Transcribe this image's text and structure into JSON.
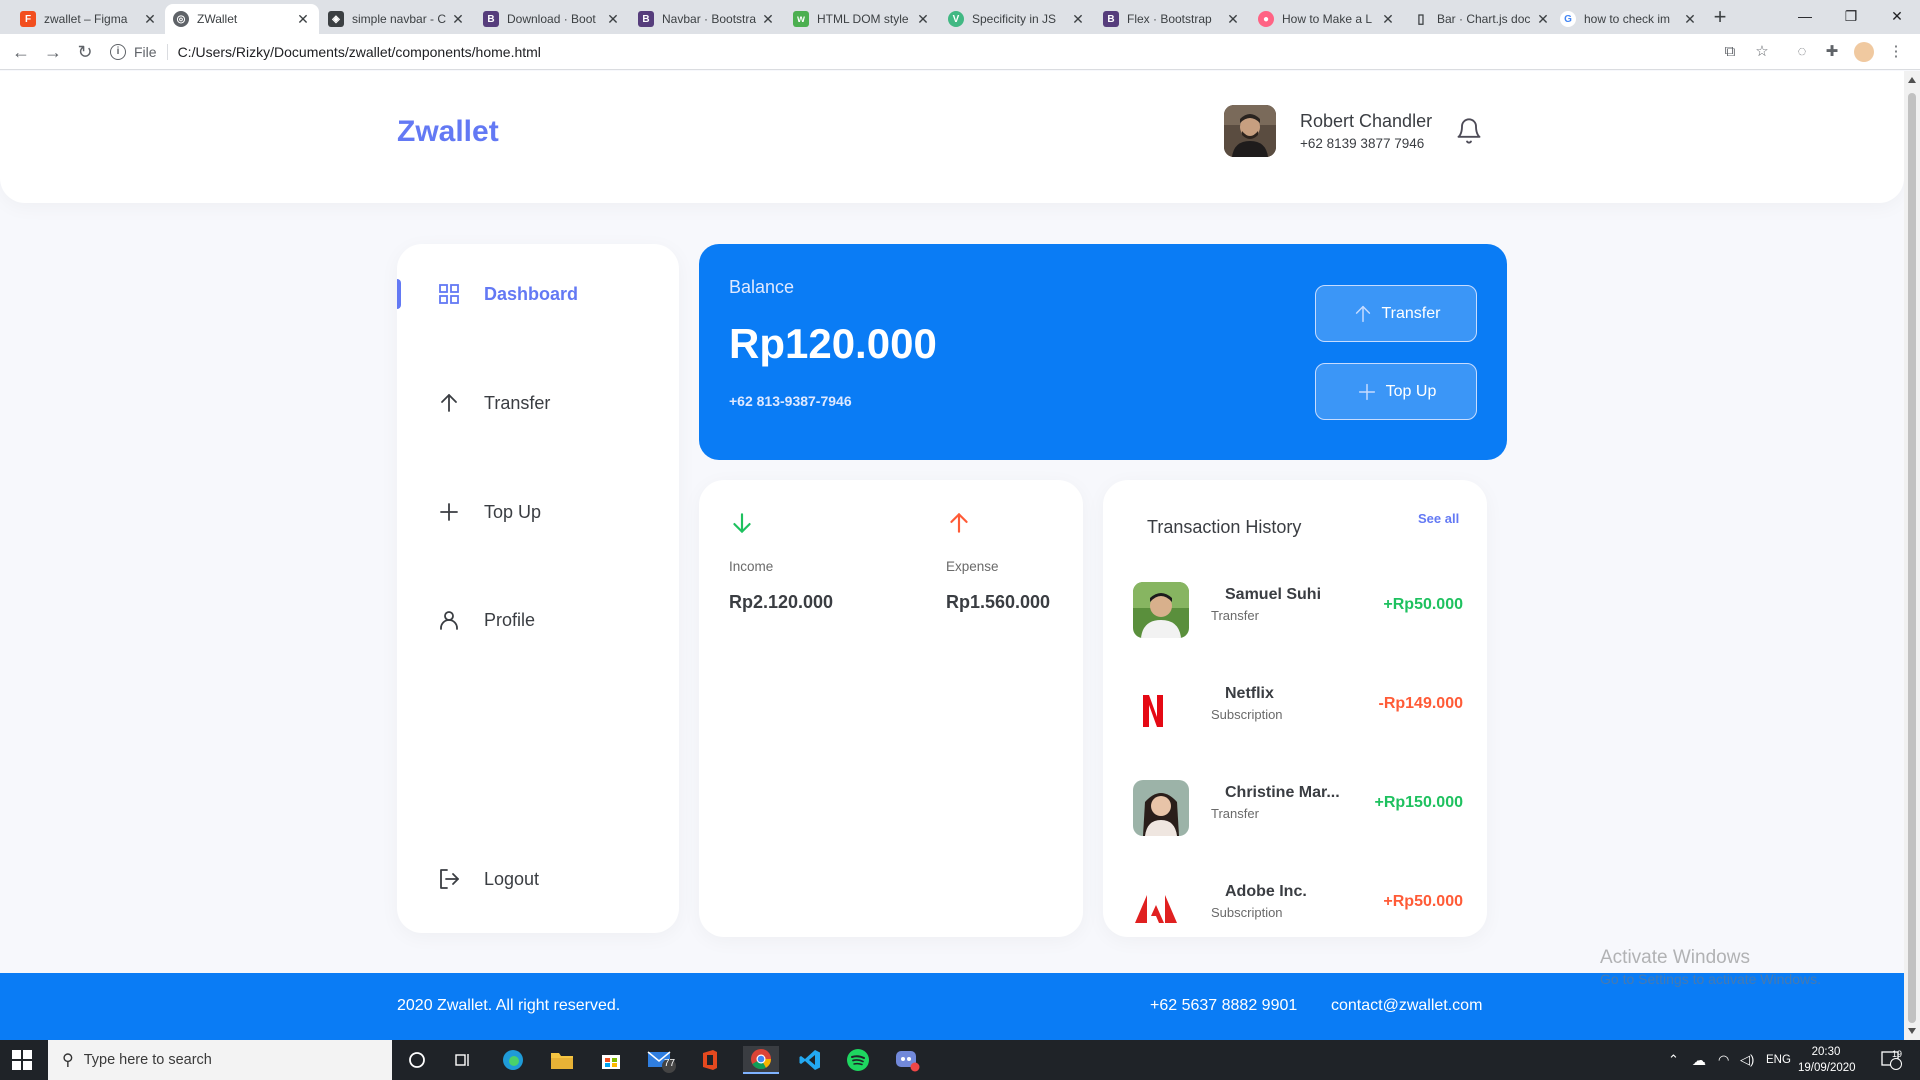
{
  "browser": {
    "tabs": [
      {
        "title": "zwallet – Figma",
        "icon": "figma-icon",
        "color": "#f24e1e"
      },
      {
        "title": "ZWallet",
        "icon": "globe-icon",
        "color": "#5f6368",
        "active": true
      },
      {
        "title": "simple navbar - C",
        "icon": "codepen-icon",
        "color": "#3c4043"
      },
      {
        "title": "Download · Boot",
        "icon": "bootstrap-icon",
        "color": "#563d7c"
      },
      {
        "title": "Navbar · Bootstra",
        "icon": "bootstrap-icon",
        "color": "#563d7c"
      },
      {
        "title": "HTML DOM style",
        "icon": "w3schools-icon",
        "color": "#4caf50"
      },
      {
        "title": "Specificity in JS",
        "icon": "vue-icon",
        "color": "#41b883"
      },
      {
        "title": "Flex · Bootstrap",
        "icon": "bootstrap-icon",
        "color": "#563d7c"
      },
      {
        "title": "How to Make a L",
        "icon": "chartjs-icon",
        "color": "#ff6384"
      },
      {
        "title": "Bar · Chart.js doc",
        "icon": "book-icon",
        "color": "#3c4043"
      },
      {
        "title": "how to check im",
        "icon": "google-icon",
        "color": "#4285f4"
      }
    ],
    "address_scheme": "File",
    "address_path": "C:/Users/Rizky/Documents/zwallet/components/home.html"
  },
  "header": {
    "brand": "Zwallet",
    "user_name": "Robert Chandler",
    "user_phone": "+62 8139 3877 7946"
  },
  "sidebar": {
    "items": [
      {
        "label": "Dashboard",
        "icon": "grid-icon",
        "active": true
      },
      {
        "label": "Transfer",
        "icon": "arrow-up-icon"
      },
      {
        "label": "Top Up",
        "icon": "plus-icon"
      },
      {
        "label": "Profile",
        "icon": "user-icon"
      },
      {
        "label": "Logout",
        "icon": "logout-icon"
      }
    ]
  },
  "balance": {
    "label": "Balance",
    "amount": "Rp120.000",
    "phone": "+62 813-9387-7946",
    "transfer_label": "Transfer",
    "topup_label": "Top Up"
  },
  "stats": {
    "income_label": "Income",
    "income_value": "Rp2.120.000",
    "expense_label": "Expense",
    "expense_value": "Rp1.560.000"
  },
  "history": {
    "title": "Transaction History",
    "see_all": "See all",
    "items": [
      {
        "name": "Samuel Suhi",
        "type": "Transfer",
        "amount": "+Rp50.000",
        "color": "#1ec15f",
        "pic": "person-photo"
      },
      {
        "name": "Netflix",
        "type": "Subscription",
        "amount": "-Rp149.000",
        "color": "#ff5b37",
        "pic": "netflix-logo"
      },
      {
        "name": "Christine Mar...",
        "type": "Transfer",
        "amount": "+Rp150.000",
        "color": "#1ec15f",
        "pic": "person-photo"
      },
      {
        "name": "Adobe Inc.",
        "type": "Subscription",
        "amount": "+Rp50.000",
        "color": "#ff5b37",
        "pic": "adobe-logo"
      }
    ]
  },
  "footer": {
    "copyright": "2020 Zwallet. All right reserved.",
    "phone": "+62 5637 8882 9901",
    "email": "contact@zwallet.com"
  },
  "watermark": {
    "line1": "Activate Windows",
    "line2": "Go to Settings to activate Windows."
  },
  "taskbar": {
    "search_placeholder": "Type here to search",
    "mail_badge": "77",
    "language": "ENG",
    "time": "20:30",
    "date": "19/09/2020",
    "notifications": "19"
  },
  "colors": {
    "primary": "#6379f4",
    "accent_blue": "#0a7cf5",
    "income_green": "#1ec15f",
    "expense_red": "#ff5b37"
  }
}
